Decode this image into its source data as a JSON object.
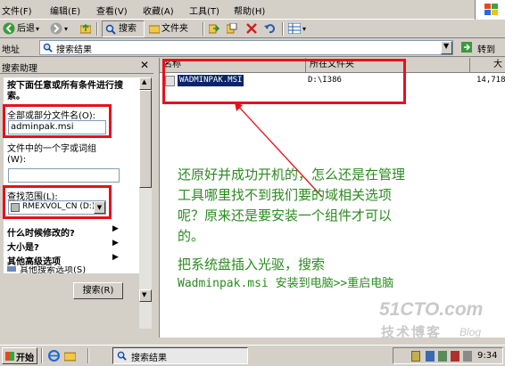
{
  "menubar": {
    "items": [
      "文件(F)",
      "编辑(E)",
      "查看(V)",
      "收藏(A)",
      "工具(T)",
      "帮助(H)"
    ]
  },
  "toolbar": {
    "back_label": "后退",
    "search_label": "搜索",
    "folders_label": "文件夹"
  },
  "addressbar": {
    "label": "地址",
    "value": "搜索结果",
    "go_label": "转到"
  },
  "search_pane": {
    "title": "搜索助理",
    "instruction": "按下面任意或所有条件进行搜索。",
    "filename_label": "全部或部分文件名(O):",
    "filename_value": "adminpak.msi",
    "phrase_label": "文件中的一个字或词组(W):",
    "phrase_value": "",
    "lookin_label": "查找范围(L):",
    "lookin_value": "RMEXVOL_CN (D:)",
    "options": [
      "什么时候修改的?",
      "大小是?",
      "其他高级选项"
    ],
    "partial_option": "其他搜索选项(S)",
    "search_button": "搜索(R)"
  },
  "results": {
    "columns": [
      "名称",
      "所在文件夹",
      "大"
    ],
    "rows": [
      {
        "name": "WADMINPAK.MSI",
        "folder": "D:\\I386",
        "size": "14,718"
      }
    ]
  },
  "annotation": {
    "line1": "还原好并成功开机的，怎么还是在管理",
    "line2": "工具哪里找不到我们要的域相关选项",
    "line3": "呢？原来还是要安装一个组件才可以",
    "line4": "的。",
    "line5": "把系统盘插入光驱，搜索",
    "line6": "Wadminpak.msi 安装到电脑>>重启电脑",
    "color": "#2b8a20"
  },
  "watermark": {
    "site": "51CTO.com",
    "sub": "技术博客",
    "blog": "Blog"
  },
  "taskbar": {
    "start_label": "开始",
    "task_label": "搜索结果",
    "clock": "9:34"
  },
  "colors": {
    "highlight_box": "#e8101c",
    "selection": "#0a246a"
  }
}
